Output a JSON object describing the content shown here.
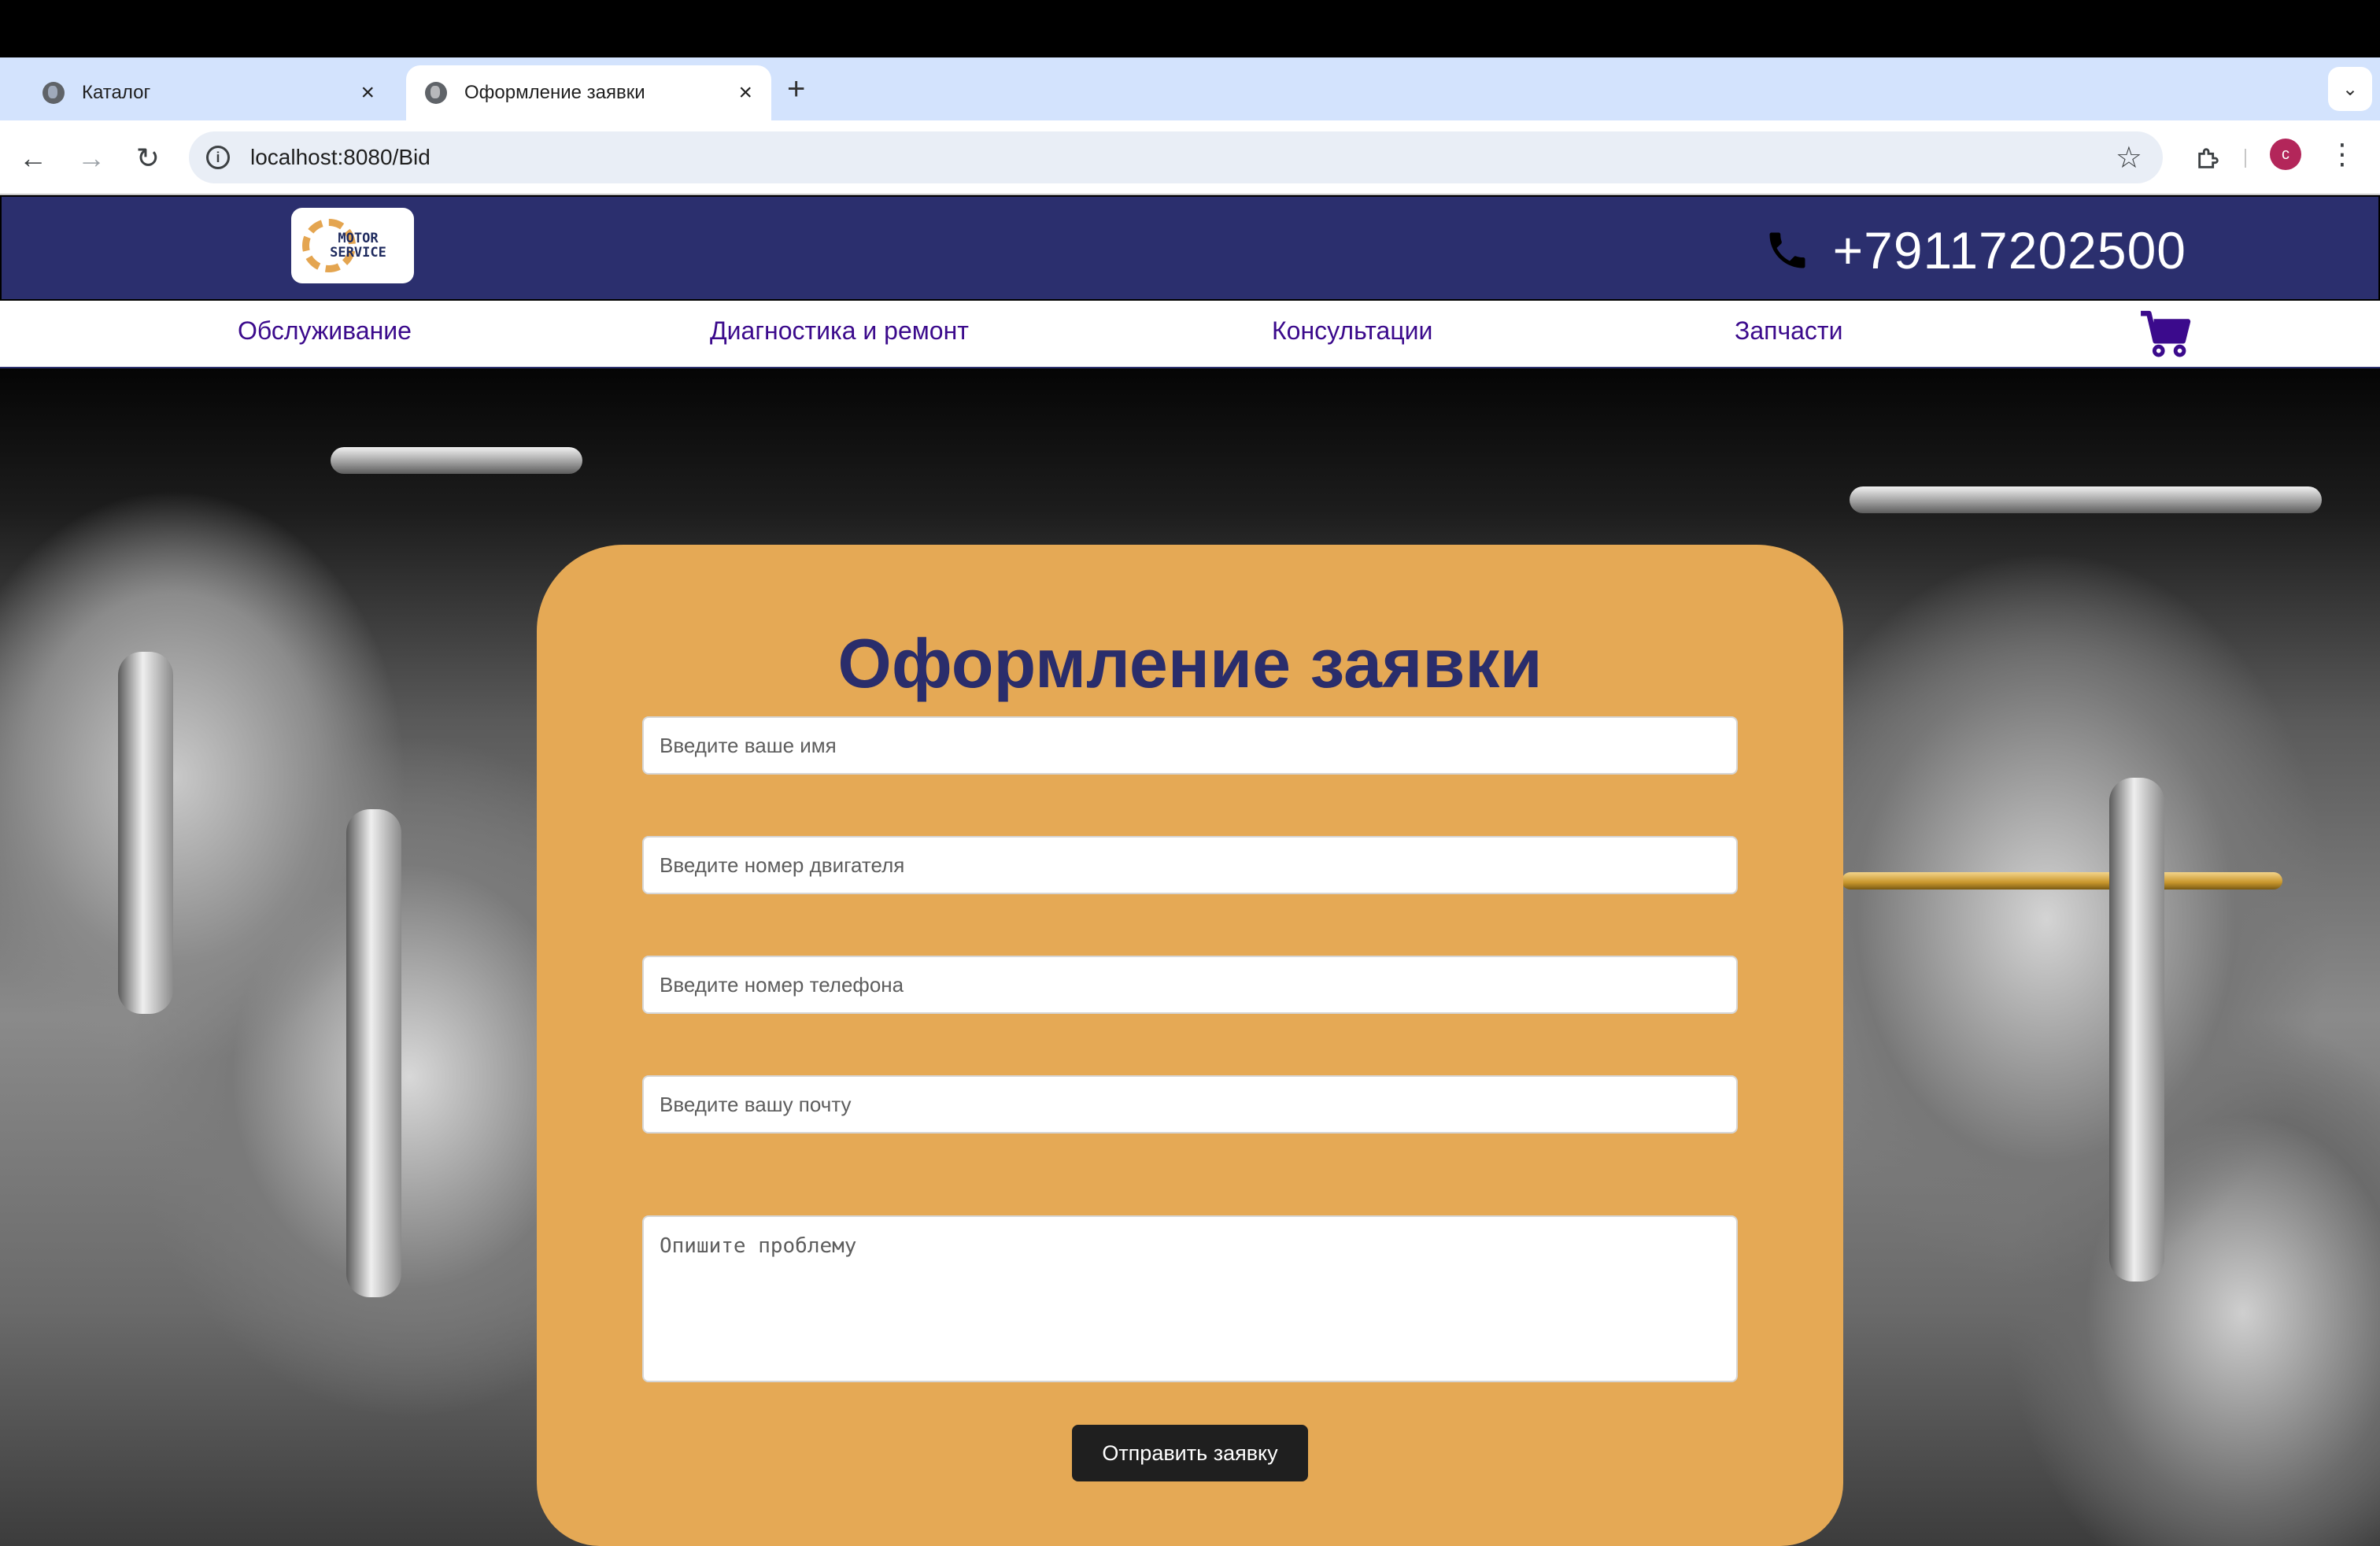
{
  "browser": {
    "tabs": [
      {
        "label": "Каталог",
        "active": false
      },
      {
        "label": "Оформление заявки",
        "active": true
      }
    ],
    "new_tab_symbol": "+",
    "url": "localhost:8080/Bid",
    "profile_initial": "c",
    "icons": [
      "back-icon",
      "forward-icon",
      "reload-icon",
      "info-icon",
      "star-icon",
      "extensions-icon",
      "menu-icon"
    ]
  },
  "site": {
    "logo_text_line1": "MOTOR",
    "logo_text_line2": "SERVICE",
    "phone": "+79117202500",
    "nav": [
      {
        "label": "Обслуживание"
      },
      {
        "label": "Диагностика и ремонт"
      },
      {
        "label": "Консультации"
      },
      {
        "label": "Запчасти"
      }
    ],
    "colors": {
      "header": "#2b2f6e",
      "nav_text": "#3b0a8c",
      "card": "#e5a955",
      "button": "#1f1f1f"
    }
  },
  "form": {
    "title": "Оформление заявки",
    "fields": {
      "name_placeholder": "Введите ваше имя",
      "engine_placeholder": "Введите номер двигателя",
      "phone_placeholder": "Введите номер телефона",
      "email_placeholder": "Введите вашу почту",
      "problem_placeholder": "Опишите проблему"
    },
    "submit_label": "Отправить заявку"
  }
}
